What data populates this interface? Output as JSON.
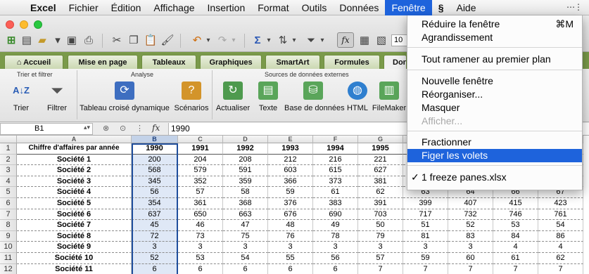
{
  "menubar": {
    "items": [
      "Excel",
      "Fichier",
      "Édition",
      "Affichage",
      "Insertion",
      "Format",
      "Outils",
      "Données",
      "Fenêtre",
      "Aide"
    ]
  },
  "ribbon_tabs": [
    "Accueil",
    "Mise en page",
    "Tableaux",
    "Graphiques",
    "SmartArt",
    "Formules",
    "Don"
  ],
  "ribbon": {
    "groups": [
      "Trier et filtrer",
      "Analyse",
      "Sources de données externes"
    ],
    "buttons": [
      "Trier",
      "Filtrer",
      "Tableau croisé dynamique",
      "Scénarios",
      "Actualiser",
      "Texte",
      "Base de données",
      "HTML",
      "FileMaker"
    ]
  },
  "toolbar": {
    "zoom": "10"
  },
  "formula_bar": {
    "namebox": "B1",
    "fx": "fx",
    "value": "1990"
  },
  "sheet": {
    "columns": [
      "A",
      "B",
      "C",
      "D",
      "E",
      "F",
      "G",
      "H",
      "I",
      "J",
      "K"
    ],
    "rows": [
      [
        "Chiffre d'affaires par année",
        "1990",
        "1991",
        "1992",
        "1993",
        "1994",
        "1995",
        "",
        "",
        "",
        ""
      ],
      [
        "Société 1",
        "200",
        "204",
        "208",
        "212",
        "216",
        "221",
        "",
        "",
        "",
        ""
      ],
      [
        "Société 2",
        "568",
        "579",
        "591",
        "603",
        "615",
        "627",
        "",
        "",
        "",
        ""
      ],
      [
        "Société 3",
        "345",
        "352",
        "359",
        "366",
        "373",
        "381",
        "",
        "",
        "",
        ""
      ],
      [
        "Société 4",
        "56",
        "57",
        "58",
        "59",
        "61",
        "62",
        "63",
        "64",
        "66",
        "67"
      ],
      [
        "Société 5",
        "354",
        "361",
        "368",
        "376",
        "383",
        "391",
        "399",
        "407",
        "415",
        "423"
      ],
      [
        "Société 6",
        "637",
        "650",
        "663",
        "676",
        "690",
        "703",
        "717",
        "732",
        "746",
        "761"
      ],
      [
        "Société 7",
        "45",
        "46",
        "47",
        "48",
        "49",
        "50",
        "51",
        "52",
        "53",
        "54"
      ],
      [
        "Société 8",
        "72",
        "73",
        "75",
        "76",
        "78",
        "79",
        "81",
        "83",
        "84",
        "86"
      ],
      [
        "Société 9",
        "3",
        "3",
        "3",
        "3",
        "3",
        "3",
        "3",
        "3",
        "4",
        "4"
      ],
      [
        "Société 10",
        "52",
        "53",
        "54",
        "55",
        "56",
        "57",
        "59",
        "60",
        "61",
        "62"
      ],
      [
        "Société 11",
        "6",
        "6",
        "6",
        "6",
        "6",
        "7",
        "7",
        "7",
        "7",
        "7"
      ],
      [
        "",
        "",
        "",
        "",
        "",
        "",
        "",
        "",
        "",
        "",
        ""
      ]
    ]
  },
  "window_menu": {
    "items": [
      {
        "label": "Réduire la fenêtre",
        "shortcut": "⌘M",
        "disabled": false
      },
      {
        "label": "Agrandissement",
        "shortcut": "",
        "disabled": false
      },
      {
        "label": "Tout ramener au premier plan",
        "shortcut": "",
        "disabled": false
      },
      {
        "label": "Nouvelle fenêtre",
        "shortcut": "",
        "disabled": false
      },
      {
        "label": "Réorganiser...",
        "shortcut": "",
        "disabled": false
      },
      {
        "label": "Masquer",
        "shortcut": "",
        "disabled": false
      },
      {
        "label": "Afficher...",
        "shortcut": "",
        "disabled": true
      },
      {
        "label": "Fractionner",
        "shortcut": "",
        "disabled": false
      },
      {
        "label": "Figer les volets",
        "shortcut": "",
        "disabled": false,
        "highlighted": true
      },
      {
        "label": "1 freeze panes.xlsx",
        "shortcut": "",
        "disabled": false,
        "checked": true
      }
    ]
  },
  "colors": {
    "menu_highlight": "#1e63dc",
    "ribbon_tabbar": "#7a9a4a",
    "selection": "#1f4e9c"
  }
}
